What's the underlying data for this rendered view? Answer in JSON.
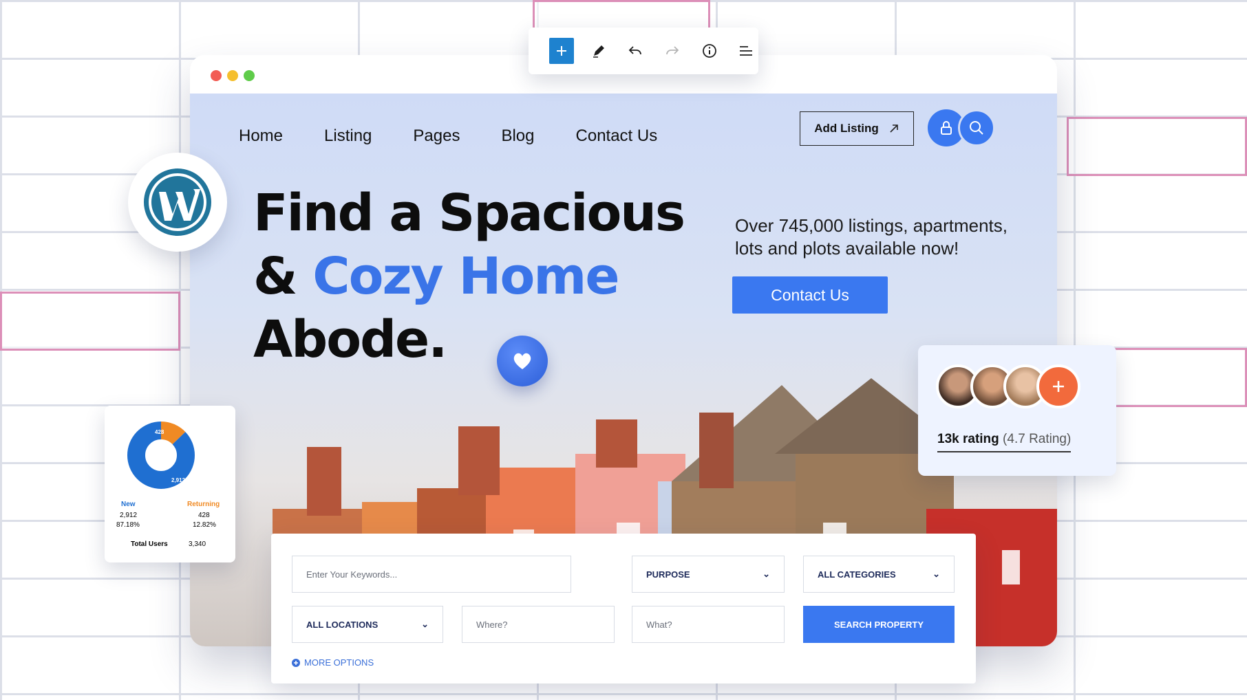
{
  "nav": {
    "items": [
      "Home",
      "Listing",
      "Pages",
      "Blog",
      "Contact Us"
    ],
    "add_listing": "Add Listing"
  },
  "hero": {
    "line1": "Find a Spacious",
    "line2_prefix": "& ",
    "line2_highlight": "Cozy Home",
    "line3": "Abode.",
    "subtitle": "Over 745,000 listings, apartments, lots and plots available now!",
    "cta": "Contact Us"
  },
  "search": {
    "keywords_placeholder": "Enter Your Keywords...",
    "purpose": "PURPOSE",
    "categories": "ALL CATEGORIES",
    "locations": "ALL LOCATIONS",
    "where_placeholder": "Where?",
    "what_placeholder": "What?",
    "button": "SEARCH PROPERTY",
    "more_options": "MORE OPTIONS"
  },
  "stats": {
    "donut_small": "428",
    "donut_big": "2,912",
    "new_label": "New",
    "returning_label": "Returning",
    "new_count": "2,912",
    "new_pct": "87.18%",
    "ret_count": "428",
    "ret_pct": "12.82%",
    "total_label": "Total Users",
    "total_value": "3,340",
    "new_fraction": 0.8718
  },
  "rating": {
    "bold": "13k rating",
    "light": "(4.7 Rating)"
  },
  "colors": {
    "accent": "#3a78f0",
    "orange": "#f26a3c",
    "donut_blue": "#1f6fd1",
    "donut_orange": "#f08a24"
  },
  "icons": [
    "plus-icon",
    "pencil-icon",
    "undo-icon",
    "redo-icon",
    "info-icon",
    "list-icon",
    "lock-icon",
    "search-icon",
    "arrow-up-right-icon",
    "wordpress-icon",
    "heart-icon",
    "chevron-down-icon",
    "plus-circle-icon"
  ]
}
